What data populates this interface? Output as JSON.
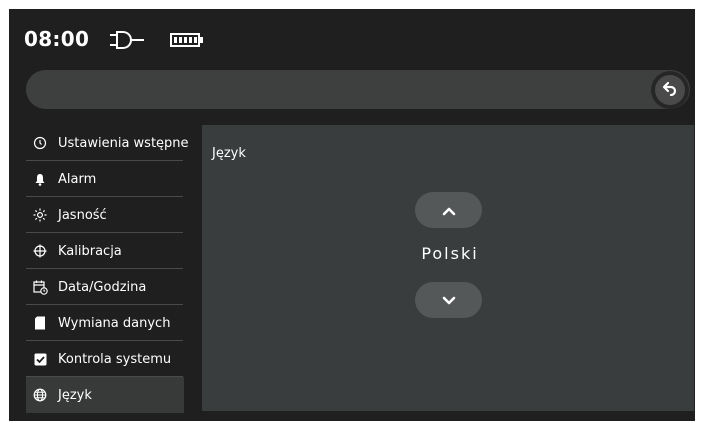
{
  "status": {
    "time": "08:00",
    "power_icon": "plug-icon",
    "battery_icon": "battery-icon"
  },
  "header": {
    "back_icon": "back-arrow-icon"
  },
  "sidebar": {
    "items": [
      {
        "label": "Ustawienia wstępne",
        "icon": "timer-icon"
      },
      {
        "label": "Alarm",
        "icon": "bell-icon"
      },
      {
        "label": "Jasność",
        "icon": "sun-icon"
      },
      {
        "label": "Kalibracja",
        "icon": "crosshair-icon"
      },
      {
        "label": "Data/Godzina",
        "icon": "calendar-clock-icon"
      },
      {
        "label": "Wymiana danych",
        "icon": "sd-card-icon"
      },
      {
        "label": "Kontrola systemu",
        "icon": "checkbox-icon"
      },
      {
        "label": "Język",
        "icon": "globe-icon"
      }
    ],
    "active_index": 7
  },
  "panel": {
    "title": "Język",
    "value": "Polski",
    "up_icon": "chevron-up-icon",
    "down_icon": "chevron-down-icon"
  }
}
